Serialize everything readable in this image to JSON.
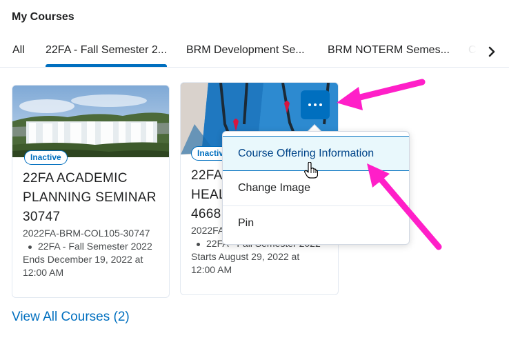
{
  "widget": {
    "title": "My Courses"
  },
  "tabs": [
    {
      "label": "All"
    },
    {
      "label": "22FA - Fall Semester 2..."
    },
    {
      "label": "BRM Development Se..."
    },
    {
      "label": "BRM NOTERM Semes..."
    },
    {
      "label": "C"
    }
  ],
  "cards": [
    {
      "status": "Inactive",
      "title_lines": [
        "22FA ACADEMIC",
        "PLANNING SEMINAR",
        "30747"
      ],
      "code": "2022FA-BRM-COL105-30747",
      "semester": "22FA - Fall Semester 2022",
      "date_lines": [
        "Ends December 19, 2022 at",
        "12:00 AM"
      ]
    },
    {
      "status": "Inactive",
      "title_lines": [
        "22FA",
        "HEAL",
        "4668"
      ],
      "code": "2022FA",
      "semester": "22FA - Fall Semester 2022",
      "date_lines": [
        "Starts August 29, 2022 at",
        "12:00 AM"
      ]
    }
  ],
  "menu": {
    "items": [
      {
        "label": "Course Offering Information"
      },
      {
        "label": "Change Image"
      },
      {
        "label": "Pin"
      }
    ]
  },
  "footer": {
    "view_all": "View All Courses (2)"
  },
  "colors": {
    "accent": "#006fbf",
    "annotation_arrow": "#ff1fc8"
  }
}
